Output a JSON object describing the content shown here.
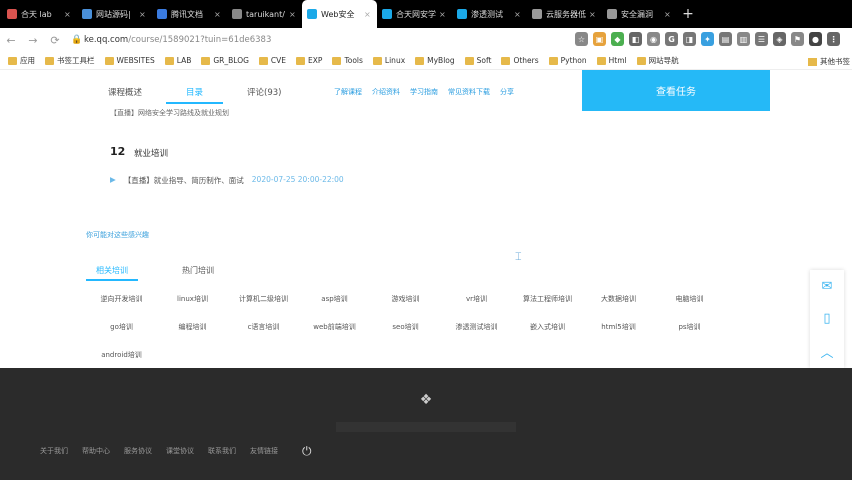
{
  "tabs": [
    {
      "title": "合天 lab",
      "color": "#d9534f",
      "active": false
    },
    {
      "title": "网站源码|",
      "color": "#4a90d9",
      "active": false
    },
    {
      "title": "腾讯文档",
      "color": "#3a7be0",
      "active": false
    },
    {
      "title": "taruikant/",
      "color": "#888888",
      "active": false
    },
    {
      "title": "Web安全",
      "color": "#1ba9e8",
      "active": true
    },
    {
      "title": "合天网安学",
      "color": "#1ba9e8",
      "active": false
    },
    {
      "title": "渗透测试",
      "color": "#1ba9e8",
      "active": false
    },
    {
      "title": "云服务器低",
      "color": "#999999",
      "active": false
    },
    {
      "title": "安全漏洞",
      "color": "#999999",
      "active": false
    }
  ],
  "new_tab_label": "+",
  "tab_close": "×",
  "address": {
    "host": "ke.qq.com",
    "path": "/course/1589021?tuin=61de6383"
  },
  "toolbar_icons": [
    {
      "name": "bookmark-star-icon",
      "glyph": "☆",
      "color": "#888888"
    },
    {
      "name": "ext-1-icon",
      "glyph": "▣",
      "color": "#e6a23c"
    },
    {
      "name": "ext-2-icon",
      "glyph": "◆",
      "color": "#4caf50"
    },
    {
      "name": "ext-3-icon",
      "glyph": "◧",
      "color": "#666666"
    },
    {
      "name": "ext-4-icon",
      "glyph": "◉",
      "color": "#888888"
    },
    {
      "name": "ext-g-icon",
      "glyph": "G",
      "color": "#777777"
    },
    {
      "name": "ext-5-icon",
      "glyph": "◨",
      "color": "#777777"
    },
    {
      "name": "ext-6-icon",
      "glyph": "✦",
      "color": "#39a0e0"
    },
    {
      "name": "ext-7-icon",
      "glyph": "▤",
      "color": "#777777"
    },
    {
      "name": "ext-8-icon",
      "glyph": "▥",
      "color": "#888888"
    },
    {
      "name": "ext-9-icon",
      "glyph": "☰",
      "color": "#777777"
    },
    {
      "name": "ext-10-icon",
      "glyph": "◈",
      "color": "#666666"
    },
    {
      "name": "ext-11-icon",
      "glyph": "⚑",
      "color": "#888888"
    },
    {
      "name": "avatar-icon",
      "glyph": "●",
      "color": "#444444"
    },
    {
      "name": "menu-icon",
      "glyph": "⋮",
      "color": "#666666"
    }
  ],
  "bookmarks": [
    "应用",
    "书签工具栏",
    "WEBSITES",
    "LAB",
    "GR_BLOG",
    "CVE",
    "EXP",
    "Tools",
    "Linux",
    "MyBlog",
    "Soft",
    "Others",
    "Python",
    "Html",
    "网站导航"
  ],
  "bookmarks_right": "其他书签",
  "course_tabs": [
    {
      "label": "课程概述",
      "active": false
    },
    {
      "label": "目录",
      "active": true
    },
    {
      "label": "评论(93)",
      "active": false
    }
  ],
  "sub_nav": [
    "了解课程",
    "介绍资料",
    "学习指南",
    "常见资料下载",
    "分享"
  ],
  "cta_label": "查看任务",
  "lesson_cut": "【直播】网络安全学习路线及就业规划",
  "chapter": {
    "number": "12",
    "title": "就业培训"
  },
  "lesson": {
    "play": "▶",
    "title": "【直播】就业指导、简历制作、面试",
    "time": "2020-07-25 20:00-22:00"
  },
  "related_title": "你可能对这些感兴趣",
  "related_tabs": [
    {
      "label": "相关培训",
      "active": true
    },
    {
      "label": "热门培训",
      "active": false
    }
  ],
  "tags": [
    "逆向开发培训",
    "linux培训",
    "计算机二级培训",
    "asp培训",
    "游戏培训",
    "vr培训",
    "算法工程师培训",
    "大数据培训",
    "电脑培训",
    "go培训",
    "编程培训",
    "c语言培训",
    "web前端培训",
    "seo培训",
    "渗透测试培训",
    "嵌入式培训",
    "html5培训",
    "ps培训",
    "android培训"
  ],
  "side_tools": [
    {
      "name": "feedback-icon",
      "glyph": "✉"
    },
    {
      "name": "phone-icon",
      "glyph": "▯"
    },
    {
      "name": "back-to-top-icon",
      "glyph": "︿"
    }
  ],
  "footer_links": [
    "关于我们",
    "帮助中心",
    "服务协议",
    "课堂协议",
    "联系我们",
    "友情链接"
  ],
  "footer_logo": "❖",
  "power_glyph": "⏻"
}
